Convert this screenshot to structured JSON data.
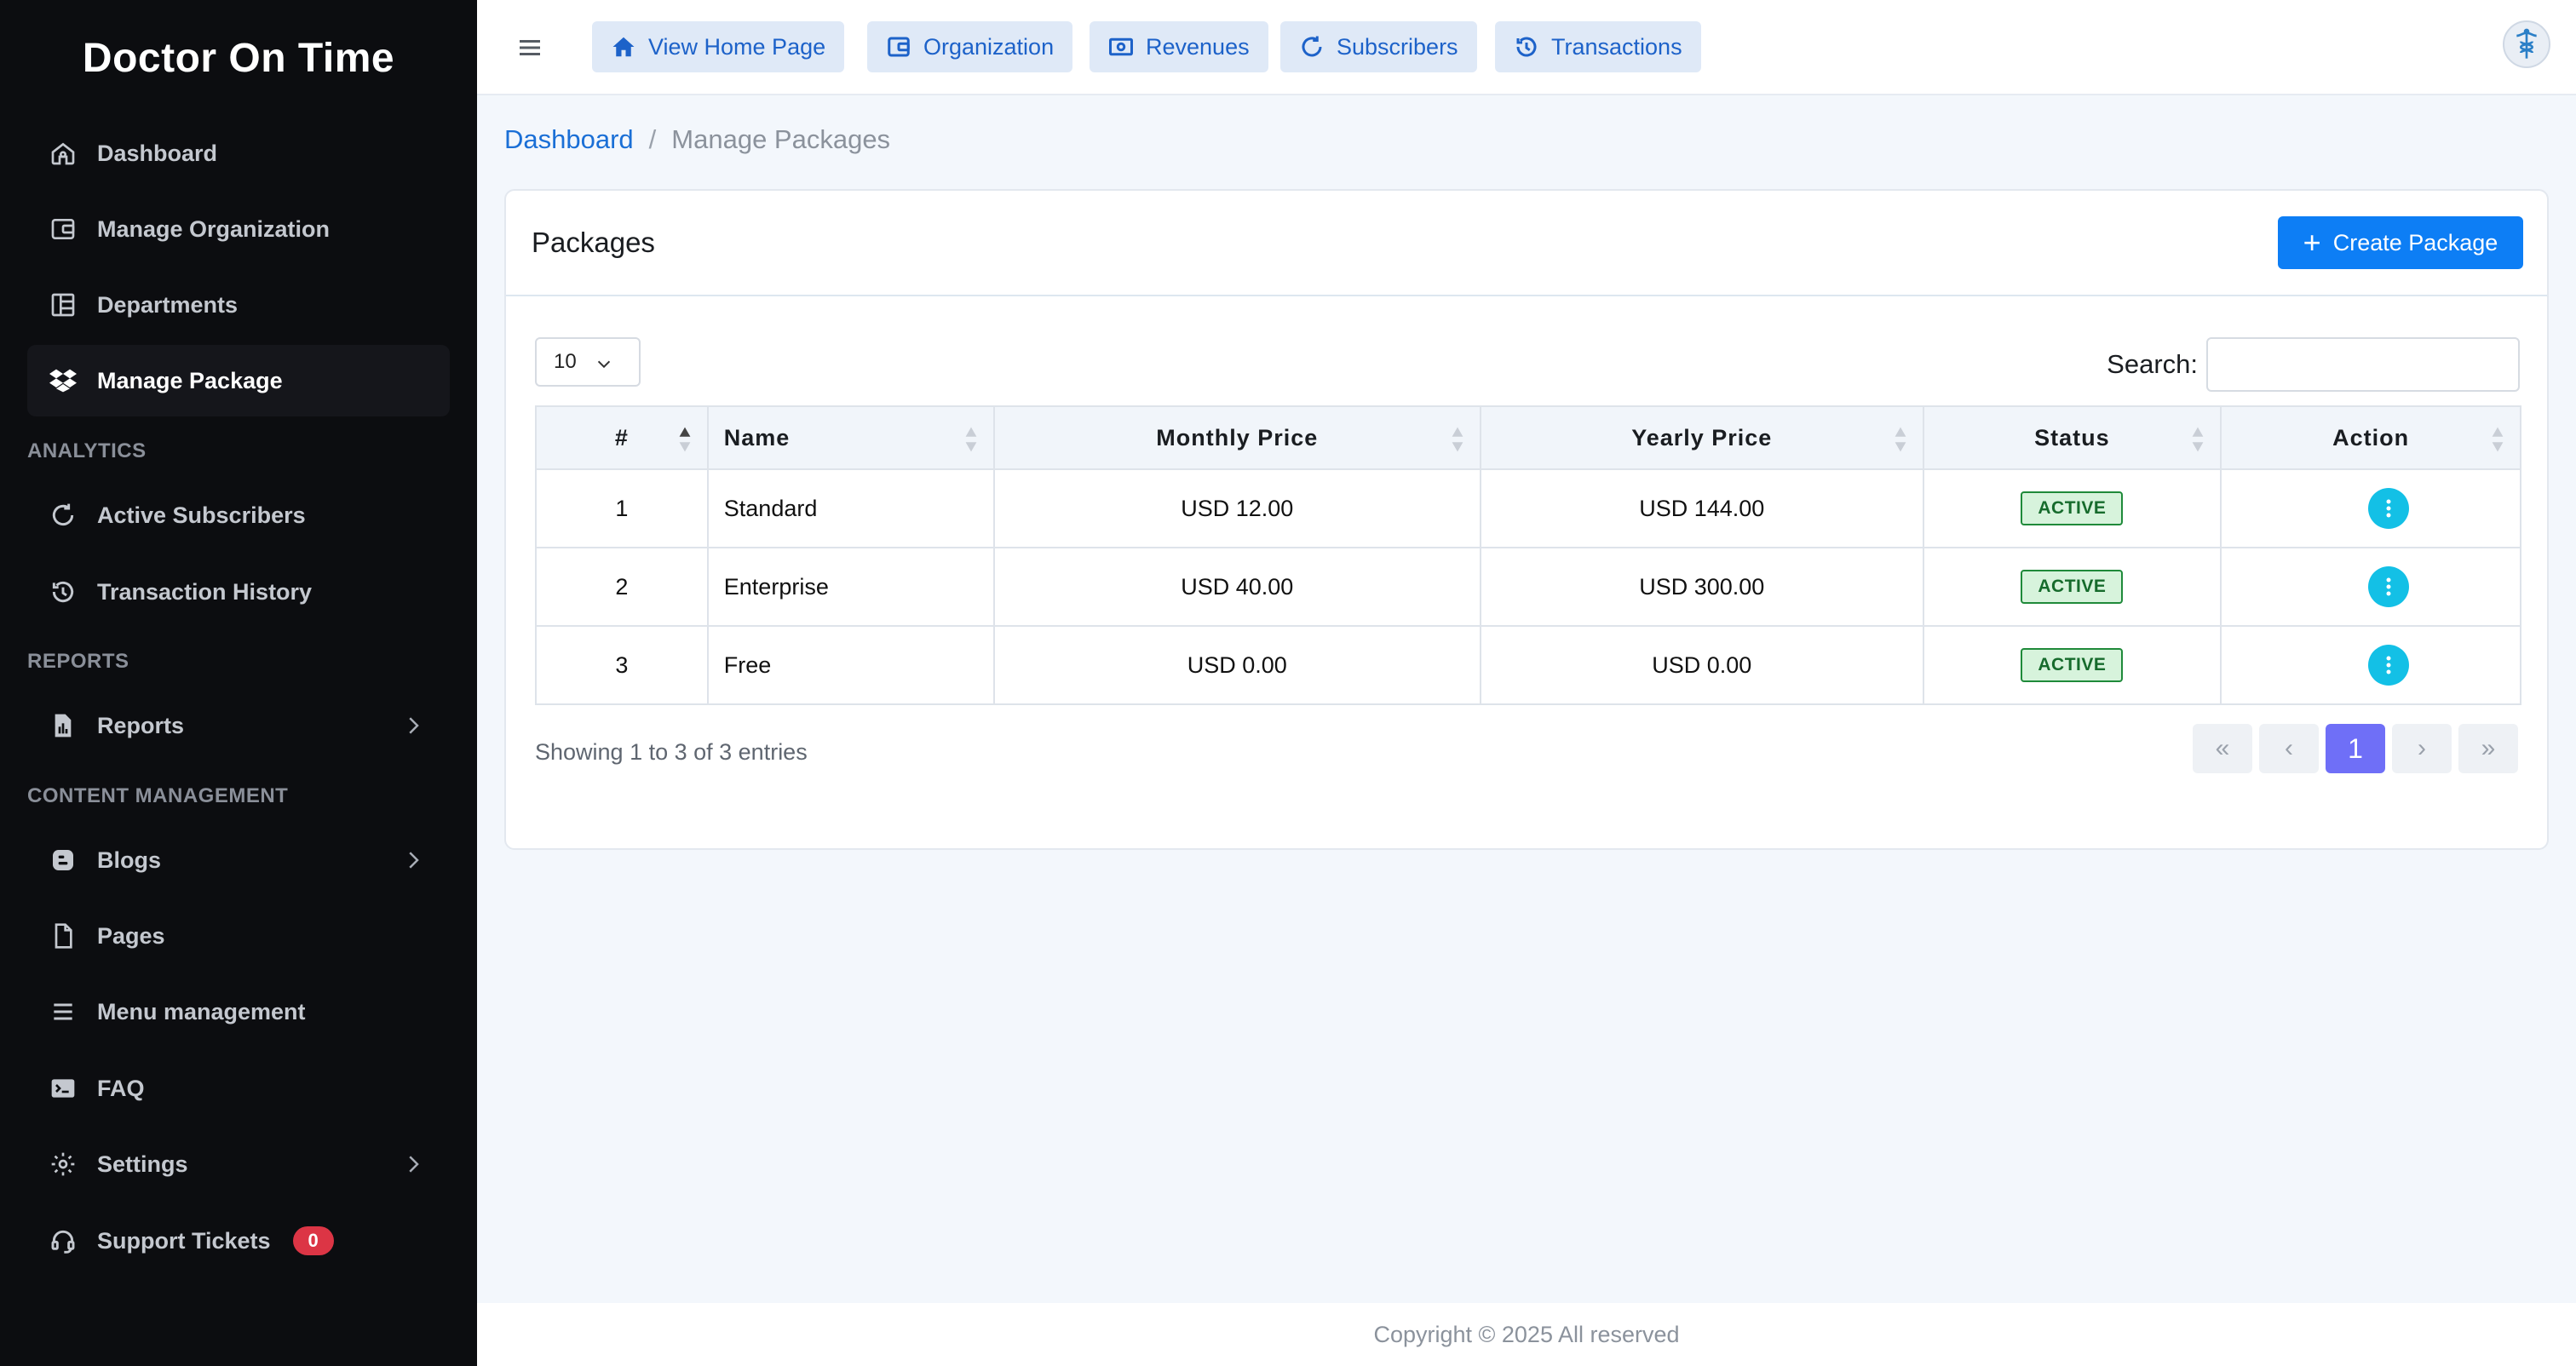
{
  "brand": {
    "title": "Doctor On Time"
  },
  "sidebar": {
    "items": [
      {
        "label": "Dashboard",
        "icon": "home-icon"
      },
      {
        "label": "Manage Organization",
        "icon": "wallet-icon"
      },
      {
        "label": "Departments",
        "icon": "layout-icon"
      },
      {
        "label": "Manage Package",
        "icon": "dropbox-icon"
      },
      {
        "label": "Active Subscribers",
        "icon": "refresh-icon"
      },
      {
        "label": "Transaction History",
        "icon": "history-icon"
      },
      {
        "label": "Reports",
        "icon": "report-icon"
      },
      {
        "label": "Blogs",
        "icon": "blog-icon"
      },
      {
        "label": "Pages",
        "icon": "file-icon"
      },
      {
        "label": "Menu management",
        "icon": "menu-icon"
      },
      {
        "label": "FAQ",
        "icon": "terminal-icon"
      },
      {
        "label": "Settings",
        "icon": "gear-icon"
      },
      {
        "label": "Support Tickets",
        "icon": "headset-icon",
        "badge": "0"
      }
    ],
    "sections": {
      "analytics": "ANALYTICS",
      "reports": "REPORTS",
      "content": "CONTENT MANAGEMENT"
    }
  },
  "topbar": {
    "buttons": [
      {
        "label": "View Home Page",
        "icon": "home-icon"
      },
      {
        "label": "Organization",
        "icon": "wallet-icon"
      },
      {
        "label": "Revenues",
        "icon": "money-icon"
      },
      {
        "label": "Subscribers",
        "icon": "refresh-icon"
      },
      {
        "label": "Transactions",
        "icon": "history-icon"
      }
    ]
  },
  "breadcrumb": {
    "root": "Dashboard",
    "separator": "/",
    "current": "Manage Packages"
  },
  "card": {
    "title": "Packages",
    "create_label": "Create Package",
    "page_length": "10",
    "search_label": "Search:",
    "search_value": ""
  },
  "table": {
    "headers": [
      "#",
      "Name",
      "Monthly Price",
      "Yearly Price",
      "Status",
      "Action"
    ],
    "rows": [
      {
        "num": "1",
        "name": "Standard",
        "monthly": "USD 12.00",
        "yearly": "USD 144.00",
        "status": "ACTIVE"
      },
      {
        "num": "2",
        "name": "Enterprise",
        "monthly": "USD 40.00",
        "yearly": "USD 300.00",
        "status": "ACTIVE"
      },
      {
        "num": "3",
        "name": "Free",
        "monthly": "USD 0.00",
        "yearly": "USD 0.00",
        "status": "ACTIVE"
      }
    ]
  },
  "pagination": {
    "info": "Showing 1 to 3 of 3 entries",
    "first": "«",
    "prev": "‹",
    "current": "1",
    "next": "›",
    "last": "»"
  },
  "footer": {
    "text": "Copyright © 2025 All reserved"
  },
  "colors": {
    "accent": "#0d7ef5",
    "sidebar_bg": "#0c0d10",
    "active_page": "#6f6ff7",
    "status_green": "#1f8a3a"
  }
}
